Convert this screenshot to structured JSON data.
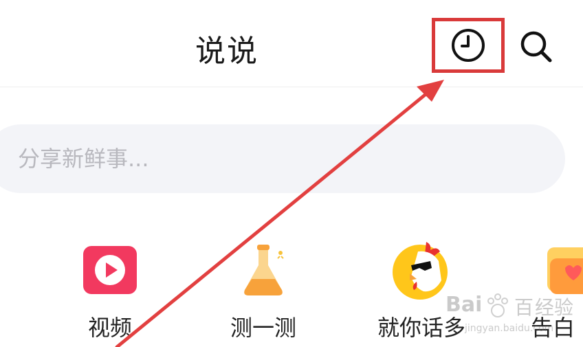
{
  "header": {
    "title": "说说"
  },
  "composer": {
    "placeholder": "分享新鲜事..."
  },
  "shortcuts": [
    {
      "label": "视频",
      "icon": "video-play-icon"
    },
    {
      "label": "测一测",
      "icon": "flask-icon"
    },
    {
      "label": "就你话多",
      "icon": "rooster-sunglasses-icon"
    },
    {
      "label": "告白",
      "icon": "heart-card-icon"
    }
  ],
  "watermark": {
    "brand": "Bai",
    "brand_tail": "百",
    "cn": "经验",
    "url": "jingyan.baidu.com"
  },
  "colors": {
    "highlight_red": "#d93a3a",
    "video_pink": "#f2395f",
    "flask_orange": "#f7a23b",
    "rooster_yellow": "#ffc61a"
  }
}
